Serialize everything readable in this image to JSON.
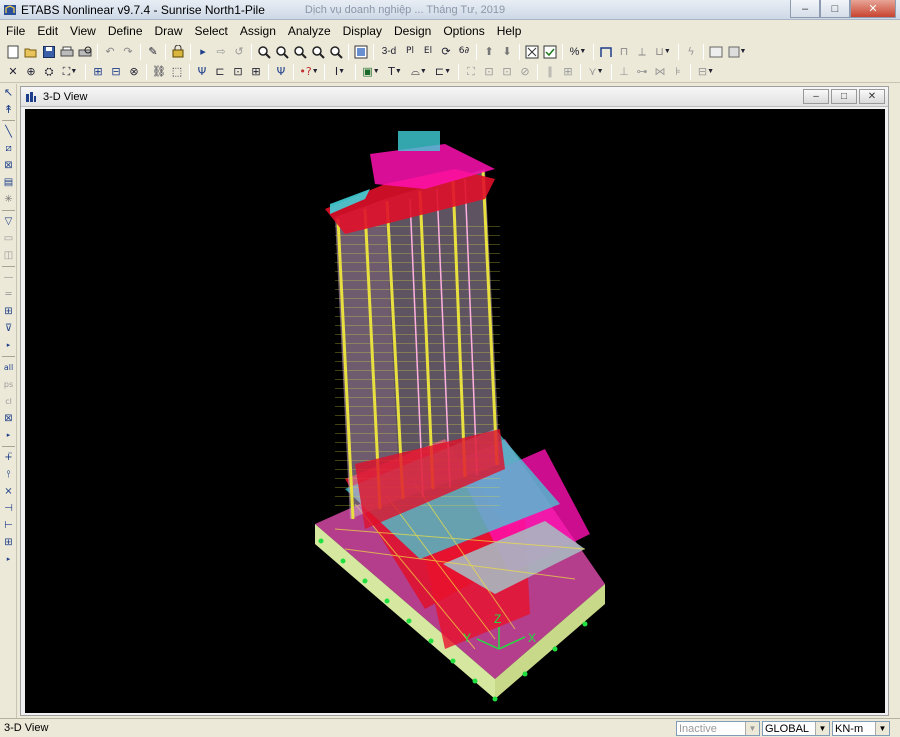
{
  "titlebar": {
    "title": "ETABS Nonlinear v9.7.4 - Sunrise North1-Pile",
    "ghost_text": "Dịch vụ doanh nghiệp    ...    Tháng Tư, 2019",
    "minimize": "–",
    "maximize": "□",
    "close": "✕"
  },
  "menu": {
    "items": [
      "File",
      "Edit",
      "View",
      "Define",
      "Draw",
      "Select",
      "Assign",
      "Analyze",
      "Display",
      "Design",
      "Options",
      "Help"
    ]
  },
  "toolbar1": {
    "icons": [
      "new-icon",
      "open-icon",
      "save-icon",
      "print-icon",
      "print-preview-icon",
      "undo-icon",
      "redo-icon",
      "refresh-icon",
      "lock-icon",
      "pointer-icon",
      "restore-view-icon",
      "zoom-window-icon",
      "zoom-in-icon",
      "zoom-out-icon",
      "zoom-fit-icon",
      "pan-icon",
      "3d-view-icon",
      "plan-view-icon",
      "elevation-view-icon",
      "rotate-view-icon",
      "perspective-icon",
      "move-up-icon",
      "move-down-icon",
      "display-options-icon",
      "check-icon",
      "shrink-icon",
      "frame-icon",
      "spring-icon",
      "link-icon",
      "run-analysis-icon",
      "graphic-icon"
    ],
    "three_d_label": "3-d",
    "percent_label": "%"
  },
  "toolbar2": {
    "icons": [
      "move-icon",
      "rotate-icon",
      "mirror-icon",
      "snap-icon",
      "plan-grid-icon",
      "elevation-grid-icon",
      "section-cut-icon",
      "level-icon",
      "joint-icon",
      "frame-draw-icon",
      "wall-icon",
      "area-icon",
      "point-icon",
      "dimension-icon",
      "reshape-icon",
      "deformed-shape-icon",
      "forces-icon",
      "design-icon",
      "contour-icon",
      "table-icon",
      "steel-frame-icon",
      "concrete-frame-icon",
      "composite-icon",
      "shear-wall-icon",
      "joist-icon",
      "frame-reinforcement-icon",
      "shell-icon",
      "output-icon"
    ]
  },
  "leftstrip": {
    "icons": [
      "select-pointer-icon",
      "reshape-object-icon",
      "draw-line-icon",
      "draw-brace-icon",
      "draw-wall-icon",
      "draw-opening-icon",
      "draw-column-icon",
      "draw-area-icon",
      "draw-rectangle-icon",
      "draw-slab-icon",
      "draw-deck-icon",
      "draw-beam-icon",
      "draw-secondary-icon",
      "draw-grid-icon",
      "draw-link-icon",
      "select-all-icon",
      "previous-select-icon",
      "clear-select-icon",
      "intersect-icon",
      "snap-point-icon",
      "snap-end-icon",
      "snap-middle-icon",
      "snap-intersection-icon",
      "snap-perpendicular-icon",
      "snap-line-icon"
    ]
  },
  "child": {
    "title": "3-D View",
    "minimize": "–",
    "restore": "□",
    "close": "✕"
  },
  "viewport": {
    "axis_labels": [
      "Y",
      "Z",
      "X"
    ]
  },
  "statusbar": {
    "text": "3-D View",
    "selection_state": "Inactive",
    "coord_system": "GLOBAL",
    "units": "KN-m"
  }
}
